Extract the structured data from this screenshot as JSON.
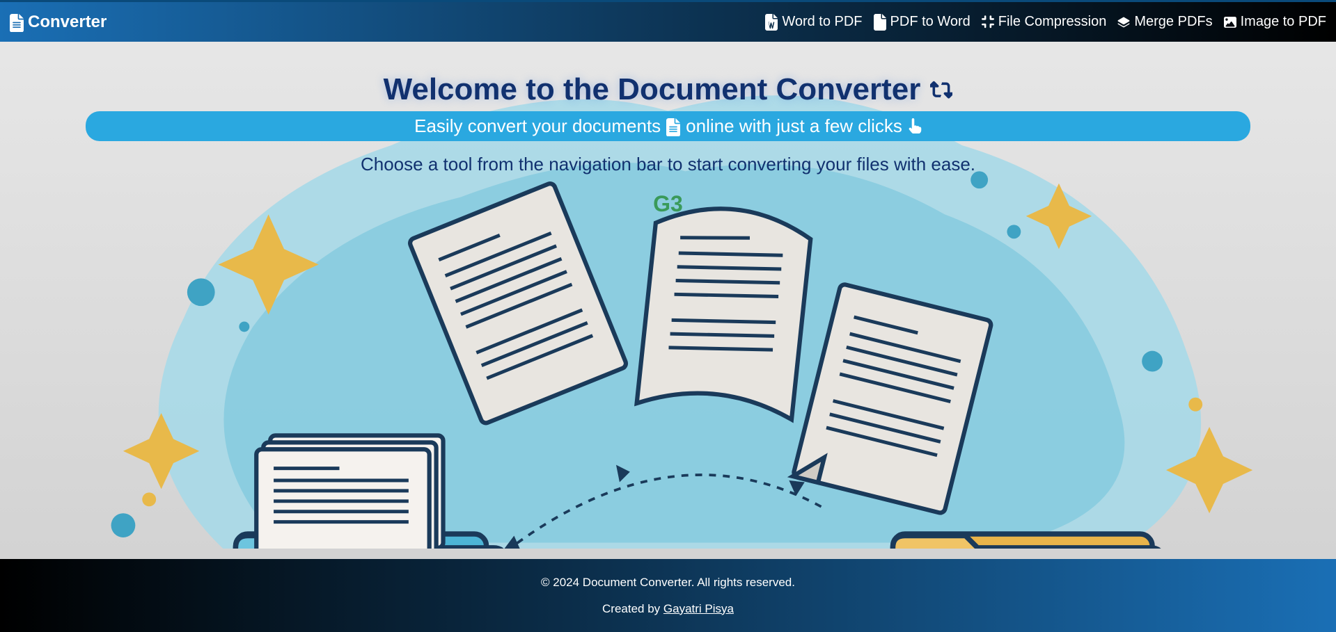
{
  "brand": {
    "name": "Converter"
  },
  "nav": {
    "items": [
      {
        "label": "Word to PDF"
      },
      {
        "label": "PDF to Word"
      },
      {
        "label": "File Compression"
      },
      {
        "label": "Merge PDFs"
      },
      {
        "label": "Image to PDF"
      }
    ]
  },
  "hero": {
    "title": "Welcome to the Document Converter",
    "subtitle_part1": "Easily convert your documents",
    "subtitle_part2": "online with just a few clicks",
    "instruction": "Choose a tool from the navigation bar to start converting your files with ease.",
    "badge": "G3"
  },
  "footer": {
    "copyright": "© 2024 Document Converter. All rights reserved.",
    "created_prefix": "Created by ",
    "author": "Gayatri Pisya"
  }
}
